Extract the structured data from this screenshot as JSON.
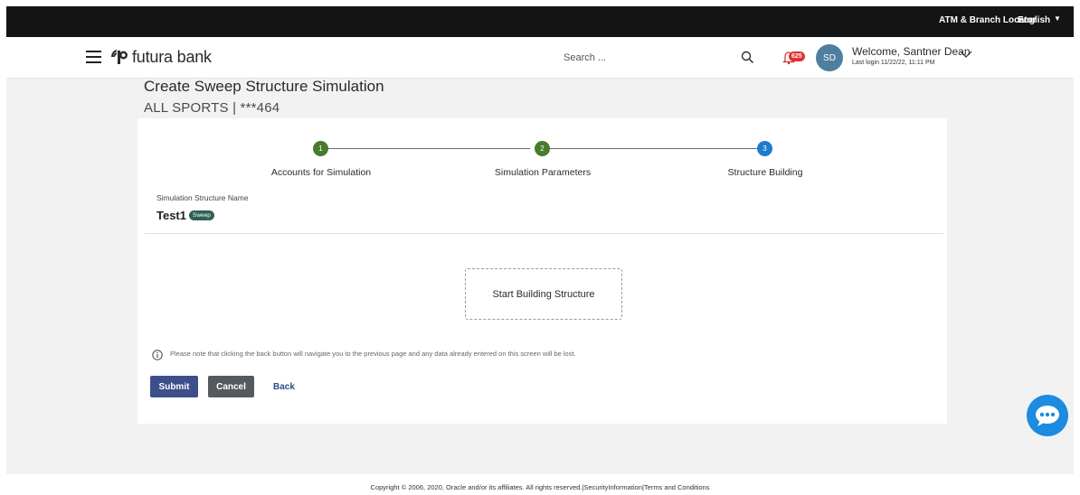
{
  "utility_bar": {
    "atm_locator": "ATM & Branch Locator",
    "language": "English"
  },
  "header": {
    "brand": "futura bank",
    "search_placeholder": "Search ...",
    "notification_count": "625",
    "avatar_initials": "SD",
    "welcome": "Welcome, Santner Dean",
    "last_login": "Last login 11/22/22, 11:11 PM"
  },
  "page": {
    "title": "Create Sweep Structure Simulation",
    "subtitle": "ALL SPORTS | ***464"
  },
  "stepper": {
    "steps": [
      {
        "number": "1",
        "label": "Accounts for Simulation",
        "status": "complete",
        "color": "#4a7a2e"
      },
      {
        "number": "2",
        "label": "Simulation Parameters",
        "status": "complete",
        "color": "#4a7a2e"
      },
      {
        "number": "3",
        "label": "Structure Building",
        "status": "current",
        "color": "#1f7bd0"
      }
    ]
  },
  "form": {
    "structure_name_label": "Simulation Structure Name",
    "structure_name_value": "Test1",
    "structure_type_tag": "Sweep",
    "build_structure_label": "Start Building Structure",
    "info_note": "Please note that clicking the back button will navigate you to the previous page and any data already entered on this screen will be lost."
  },
  "actions": {
    "submit": "Submit",
    "cancel": "Cancel",
    "back": "Back"
  },
  "footer": {
    "copyright": "Copyright © 2006, 2020, Oracle and/or its affiliates. All rights reserved.|SecurityInformation|Terms and Conditions"
  },
  "colors": {
    "utility_bar": "#141414",
    "submit": "#3d4f8a",
    "cancel": "#555a5e",
    "chat": "#1c8be0",
    "badge": "#e0322d",
    "sweep_tag": "#2f5f56"
  }
}
